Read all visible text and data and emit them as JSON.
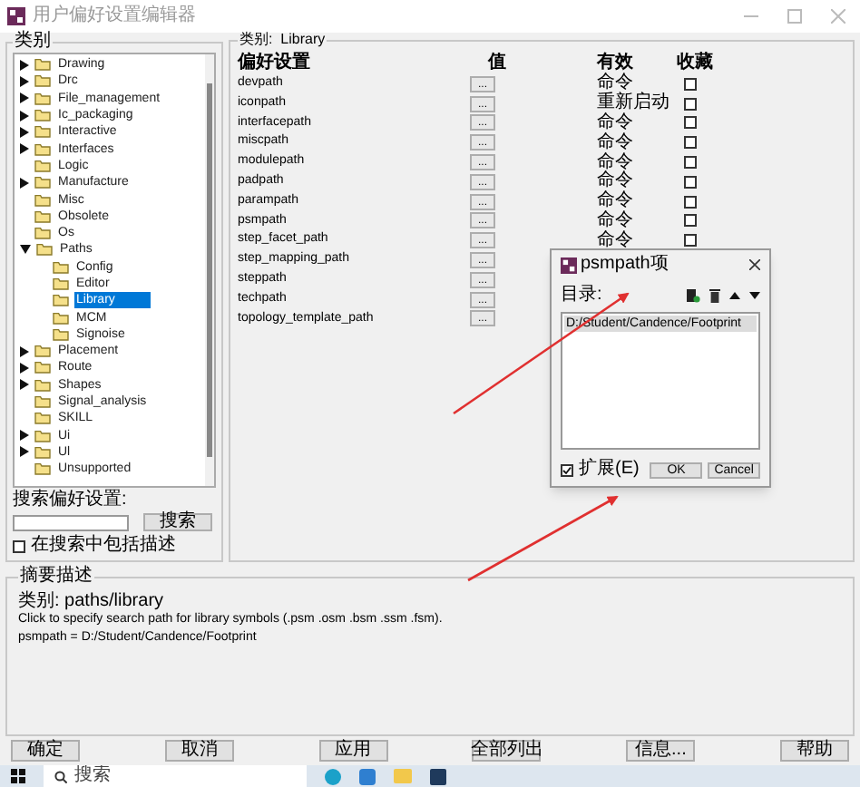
{
  "window": {
    "title": "用户偏好设置编辑器"
  },
  "categories": {
    "legend": "类别",
    "tree": [
      {
        "label": "Drawing",
        "expanded": false,
        "selected": false
      },
      {
        "label": "Drc",
        "expanded": false,
        "selected": false
      },
      {
        "label": "File_management",
        "expanded": false,
        "selected": false
      },
      {
        "label": "Ic_packaging",
        "expanded": false,
        "selected": false
      },
      {
        "label": "Interactive",
        "expanded": false,
        "selected": false
      },
      {
        "label": "Interfaces",
        "expanded": false,
        "selected": false
      },
      {
        "label": "Logic",
        "selected": false
      },
      {
        "label": "Manufacture",
        "expanded": false,
        "selected": false
      },
      {
        "label": "Misc",
        "selected": false
      },
      {
        "label": "Obsolete",
        "selected": false
      },
      {
        "label": "Os",
        "selected": false
      },
      {
        "label": "Paths",
        "expanded": true,
        "selected": false,
        "children": [
          {
            "label": "Config",
            "selected": false
          },
          {
            "label": "Editor",
            "selected": false
          },
          {
            "label": "Library",
            "selected": true
          },
          {
            "label": "MCM",
            "selected": false
          },
          {
            "label": "Signoise",
            "selected": false
          }
        ]
      },
      {
        "label": "Placement",
        "expanded": false,
        "selected": false
      },
      {
        "label": "Route",
        "expanded": false,
        "selected": false
      },
      {
        "label": "Shapes",
        "expanded": false,
        "selected": false
      },
      {
        "label": "Signal_analysis",
        "selected": false
      },
      {
        "label": "SKILL",
        "selected": false
      },
      {
        "label": "Ui",
        "expanded": false,
        "selected": false
      },
      {
        "label": "Ul",
        "expanded": false,
        "selected": false
      },
      {
        "label": "Unsupported",
        "selected": false
      }
    ],
    "search_label": "搜索偏好设置:",
    "search_button": "搜索",
    "include_description": {
      "label": "在搜索中包括描述",
      "checked": false
    }
  },
  "preferences": {
    "legend": "类别:  Library",
    "columns": [
      "偏好设置",
      "值",
      "有效",
      "收藏"
    ],
    "rows": [
      {
        "name": "devpath",
        "value_button": "...",
        "effective": "命令",
        "favorite": false
      },
      {
        "name": "iconpath",
        "value_button": "...",
        "effective": "重新启动",
        "favorite": false
      },
      {
        "name": "interfacepath",
        "value_button": "...",
        "effective": "命令",
        "favorite": false
      },
      {
        "name": "miscpath",
        "value_button": "...",
        "effective": "命令",
        "favorite": false
      },
      {
        "name": "modulepath",
        "value_button": "...",
        "effective": "命令",
        "favorite": false
      },
      {
        "name": "padpath",
        "value_button": "...",
        "effective": "命令",
        "favorite": false
      },
      {
        "name": "parampath",
        "value_button": "...",
        "effective": "命令",
        "favorite": false
      },
      {
        "name": "psmpath",
        "value_button": "...",
        "effective": "命令",
        "favorite": false
      },
      {
        "name": "step_facet_path",
        "value_button": "...",
        "effective": "命令",
        "favorite": false
      },
      {
        "name": "step_mapping_path",
        "value_button": "..."
      },
      {
        "name": "steppath",
        "value_button": "..."
      },
      {
        "name": "techpath",
        "value_button": "..."
      },
      {
        "name": "topology_template_path",
        "value_button": "..."
      }
    ]
  },
  "description": {
    "legend": "摘要描述",
    "lines": [
      "类别: paths/library",
      "Click to specify search path for library symbols (.psm .osm .bsm .ssm .fsm).",
      "psmpath = D:/Student/Candence/Footprint"
    ]
  },
  "buttons": [
    "确定",
    "取消",
    "应用",
    "全部列出",
    "信息...",
    "帮助"
  ],
  "dialog": {
    "title": "psmpath项",
    "directory_label": "目录:",
    "items": [
      {
        "label": "D:/Student/Candence/Footprint",
        "selected": true
      }
    ],
    "expand": {
      "label": "扩展(E)",
      "checked": true
    },
    "buttons": [
      "OK",
      "Cancel"
    ]
  },
  "taskbar": {
    "search_placeholder": "搜索"
  }
}
